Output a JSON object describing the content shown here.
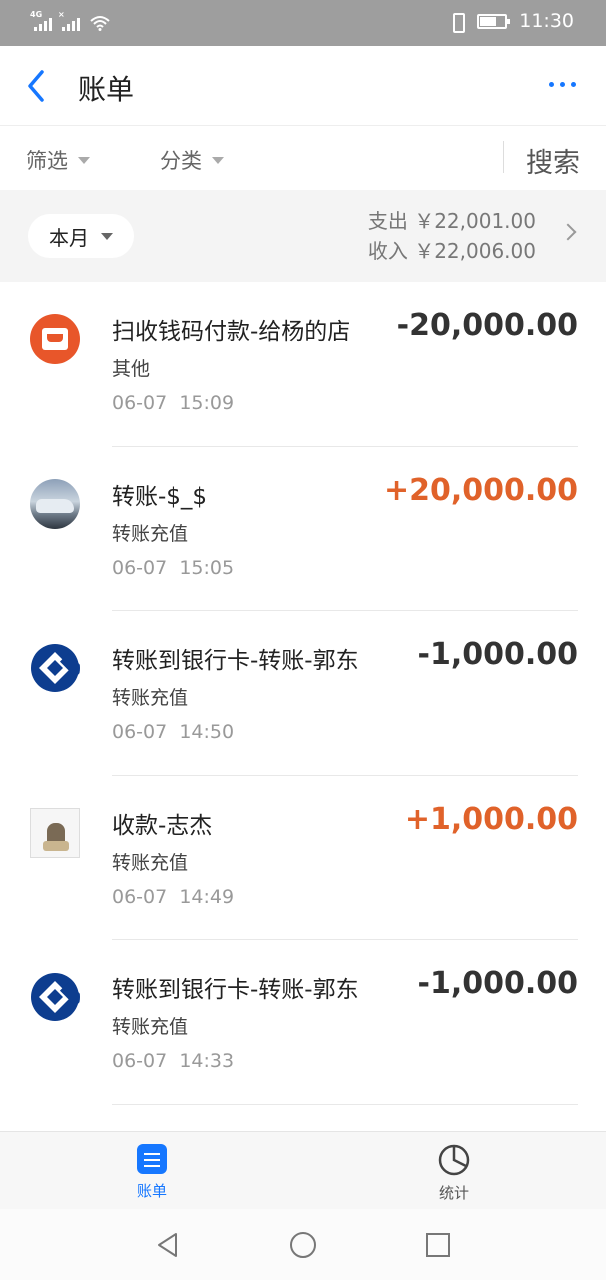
{
  "status_bar": {
    "network_1": "4G",
    "network_2": "×",
    "time": "11:30"
  },
  "header": {
    "title": "账单"
  },
  "filters": {
    "filter_label": "筛选",
    "category_label": "分类",
    "search_label": "搜索"
  },
  "summary": {
    "month_label": "本月",
    "expense_label": "支出",
    "expense_amount": "￥22,001.00",
    "income_label": "收入",
    "income_amount": "￥22,006.00"
  },
  "transactions": [
    {
      "title": "扫收钱码付款-给杨的店",
      "category": "其他",
      "date": "06-07",
      "time": "15:09",
      "amount": "-20,000.00",
      "direction": "out",
      "avatar": "shop-icon"
    },
    {
      "title": "转账-$_$",
      "category": "转账充值",
      "date": "06-07",
      "time": "15:05",
      "amount": "+20,000.00",
      "direction": "in",
      "avatar": "car-avatar"
    },
    {
      "title": "转账到银行卡-转账-郭东",
      "category": "转账充值",
      "date": "06-07",
      "time": "14:50",
      "amount": "-1,000.00",
      "direction": "out",
      "avatar": "bank-logo-icon"
    },
    {
      "title": "收款-志杰",
      "category": "转账充值",
      "date": "06-07",
      "time": "14:49",
      "amount": "+1,000.00",
      "direction": "in",
      "avatar": "photo-avatar"
    },
    {
      "title": "转账到银行卡-转账-郭东",
      "category": "转账充值",
      "date": "06-07",
      "time": "14:33",
      "amount": "-1,000.00",
      "direction": "out",
      "avatar": "bank-logo-icon"
    }
  ],
  "tabbar": {
    "bill_label": "账单",
    "stats_label": "统计"
  },
  "colors": {
    "accent": "#1677ff",
    "income": "#e0622a",
    "shop": "#e8562a",
    "bank": "#0d3d8f"
  }
}
